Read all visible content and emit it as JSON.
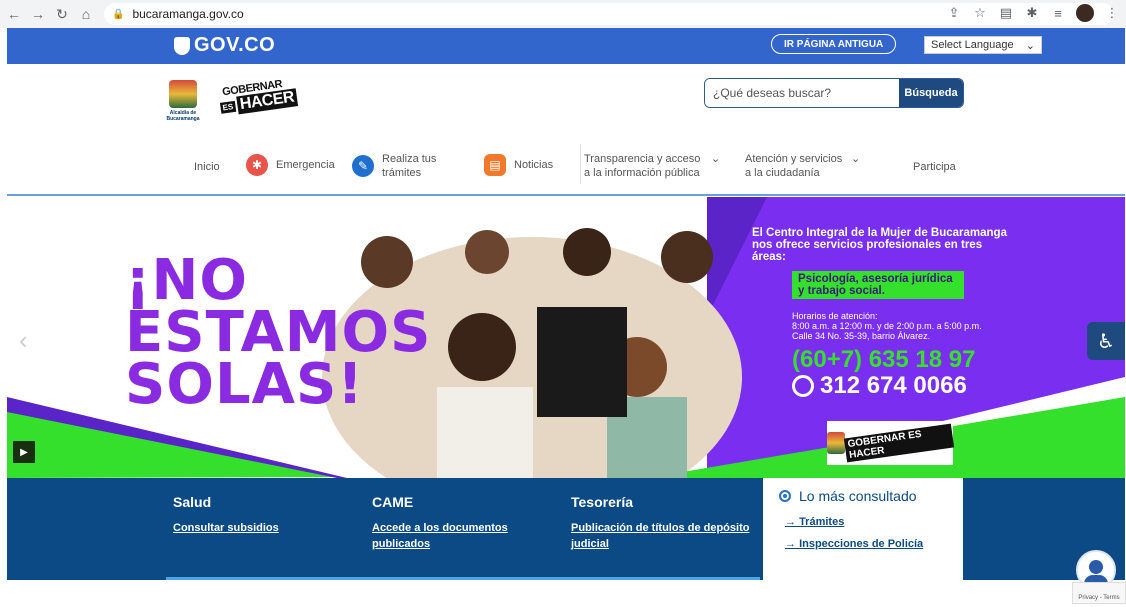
{
  "browser": {
    "url": "bucaramanga.gov.co"
  },
  "gov_bar": {
    "logo_text": "GOV.CO",
    "old_page_button": "IR PÁGINA ANTIGUA",
    "language_select": "Select Language"
  },
  "header": {
    "crest_label": "Alcaldía de Bucaramanga",
    "gob_line1": "GOBERNAR",
    "gob_es": "ES",
    "gob_hacer": "HACER",
    "search_placeholder": "¿Qué deseas buscar?",
    "search_button": "Búsqueda"
  },
  "menu": {
    "inicio": "Inicio",
    "emergencia": "Emergencia",
    "tramites": "Realiza tus trámites",
    "noticias": "Noticias",
    "transparencia": "Transparencia y acceso a la información pública",
    "atencion": "Atención y servicios a la ciudadanía",
    "participa": "Participa"
  },
  "hero": {
    "title_line1": "¡NO",
    "title_line2": "ESTAMOS",
    "title_line3": "SOLAS!",
    "intro": "El Centro Integral de la Mujer de Bucaramanga nos ofrece servicios profesionales en tres áreas:",
    "areas": "Psicología, asesoría jurídica y trabajo social.",
    "hours_label": "Horarios de atención:",
    "hours": "8:00 a.m. a 12:00 m. y de 2:00 p.m. a 5:00 p.m.",
    "address": "Calle 34 No. 35-39, barrio Álvarez.",
    "phone1": "(60+7) 635 18 97",
    "phone2": "312 674 0066",
    "card_gob": "GOBERNAR ES HACER"
  },
  "bottom": {
    "salud_title": "Salud",
    "salud_link": "Consultar subsidios",
    "came_title": "CAME",
    "came_link": "Accede a los documentos publicados",
    "tesoreria_title": "Tesorería",
    "tesoreria_link": "Publicación de títulos de depósito judicial",
    "mas_title": "Lo más consultado",
    "mas_link1": "Trámites",
    "mas_link2": "Inspecciones de Policía"
  },
  "recaptcha": "Privacy - Terms",
  "colors": {
    "gov_blue": "#3366cc",
    "band_blue": "#0c4a85",
    "hero_purple": "#8a2be2",
    "hero_green": "#34e02b"
  }
}
